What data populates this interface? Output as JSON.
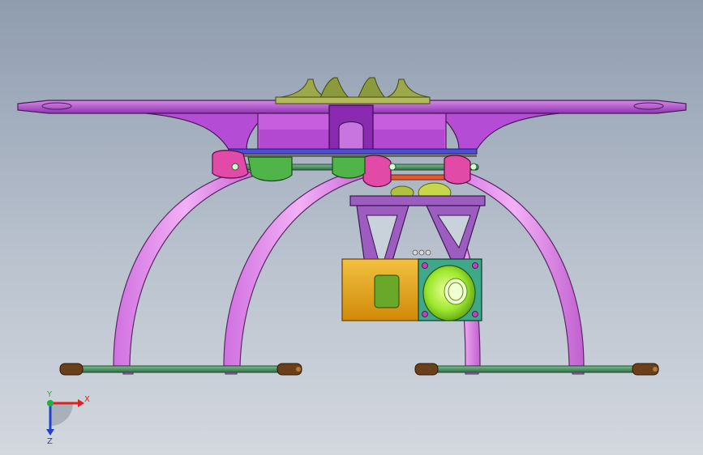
{
  "viewport": {
    "background_top": "#8f9caf",
    "background_bottom": "#d3d8df"
  },
  "model": {
    "parts": [
      {
        "name": "top-plate",
        "color": "#b44cd6"
      },
      {
        "name": "center-hub",
        "color": "#8a9a3c"
      },
      {
        "name": "landing-leg",
        "color": "#e690ee"
      },
      {
        "name": "leg-clamp",
        "color": "#e24aa8"
      },
      {
        "name": "center-clamp",
        "color": "#4fb548"
      },
      {
        "name": "skid-rod",
        "color": "#4a8a5c"
      },
      {
        "name": "end-cap",
        "color": "#6b3f1a"
      },
      {
        "name": "gimbal-bracket",
        "color": "#9c5cc0"
      },
      {
        "name": "camera-body",
        "color": "#e6a616"
      },
      {
        "name": "camera-lens",
        "color": "#9fe82e"
      },
      {
        "name": "lens-housing",
        "color": "#3fa888"
      }
    ]
  },
  "triad": {
    "x_label": "X",
    "y_label": "Y",
    "z_label": "Z",
    "x_color": "#e02020",
    "y_color": "#20b040",
    "z_color": "#2040d0"
  }
}
